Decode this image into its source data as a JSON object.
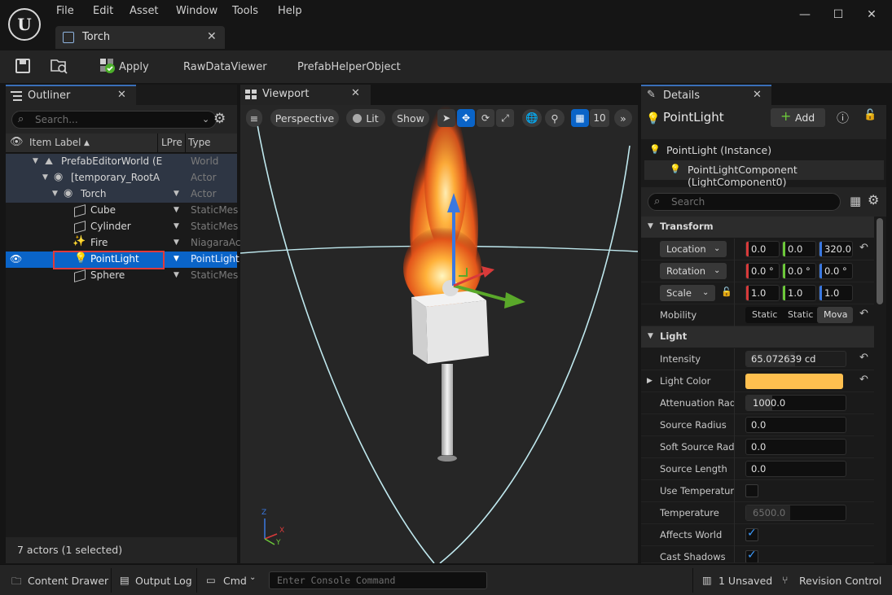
{
  "window": {
    "menu": [
      "File",
      "Edit",
      "Asset",
      "Window",
      "Tools",
      "Help"
    ],
    "doc_tab": "Torch",
    "controls": {
      "minimize": "—",
      "maximize": "☐",
      "close": "✕"
    }
  },
  "toolbar": {
    "apply_label": "Apply",
    "raw_data_viewer_label": "RawDataViewer",
    "prefab_helper_label": "PrefabHelperObject"
  },
  "outliner": {
    "tab_label": "Outliner",
    "search_placeholder": "Search...",
    "columns": {
      "label": "Item Label",
      "lpre": "LPre",
      "type": "Type"
    },
    "rows": [
      {
        "label": "PrefabEditorWorld (E",
        "type": "World"
      },
      {
        "label": "[temporary_RootA",
        "type": "Actor"
      },
      {
        "label": "Torch",
        "type": "Actor"
      },
      {
        "label": "Cube",
        "type": "StaticMes"
      },
      {
        "label": "Cylinder",
        "type": "StaticMes"
      },
      {
        "label": "Fire",
        "type": "NiagaraAc"
      },
      {
        "label": "PointLight",
        "type": "PointLight"
      },
      {
        "label": "Sphere",
        "type": "StaticMes"
      }
    ],
    "footer": "7 actors (1 selected)"
  },
  "viewport": {
    "tab_label": "Viewport",
    "perspective_label": "Perspective",
    "lit_label": "Lit",
    "show_label": "Show",
    "grid_snap_value": "10"
  },
  "details": {
    "tab_label": "Details",
    "title": "PointLight",
    "add_label": "Add",
    "instance_label": "PointLight (Instance)",
    "component_label": "PointLightComponent (LightComponent0)",
    "search_placeholder": "Search",
    "transform": {
      "header": "Transform",
      "location_label": "Location",
      "location": [
        "0.0",
        "0.0",
        "320.0"
      ],
      "rotation_label": "Rotation",
      "rotation": [
        "0.0 °",
        "0.0 °",
        "0.0 °"
      ],
      "scale_label": "Scale",
      "scale": [
        "1.0",
        "1.0",
        "1.0"
      ],
      "mobility_label": "Mobility",
      "mobility_options": [
        "Static",
        "Static",
        "Mova"
      ]
    },
    "light": {
      "header": "Light",
      "intensity_label": "Intensity",
      "intensity": "65.072639 cd",
      "light_color_label": "Light Color",
      "light_color": "#ffc04f",
      "attenuation_label": "Attenuation Radi",
      "attenuation": "1000.0",
      "source_radius_label": "Source Radius",
      "source_radius": "0.0",
      "soft_source_label": "Soft Source Radi",
      "soft_source": "0.0",
      "source_length_label": "Source Length",
      "source_length": "0.0",
      "use_temperature_label": "Use Temperature",
      "use_temperature": false,
      "temperature_label": "Temperature",
      "temperature": "6500.0",
      "affects_world_label": "Affects World",
      "affects_world": true,
      "cast_shadows_label": "Cast Shadows",
      "cast_shadows": true
    }
  },
  "statusbar": {
    "content_drawer_label": "Content Drawer",
    "output_log_label": "Output Log",
    "cmd_label": "Cmd",
    "console_placeholder": "Enter Console Command",
    "unsaved_label": "1 Unsaved",
    "revision_control_label": "Revision Control"
  },
  "colors": {
    "selection": "#0a64c8",
    "accent_tab": "#3a6fb8",
    "highlight_box": "#e03a3a",
    "axis_x": "#d83a3a",
    "axis_y": "#6cc93a",
    "axis_z": "#3a78e0"
  }
}
